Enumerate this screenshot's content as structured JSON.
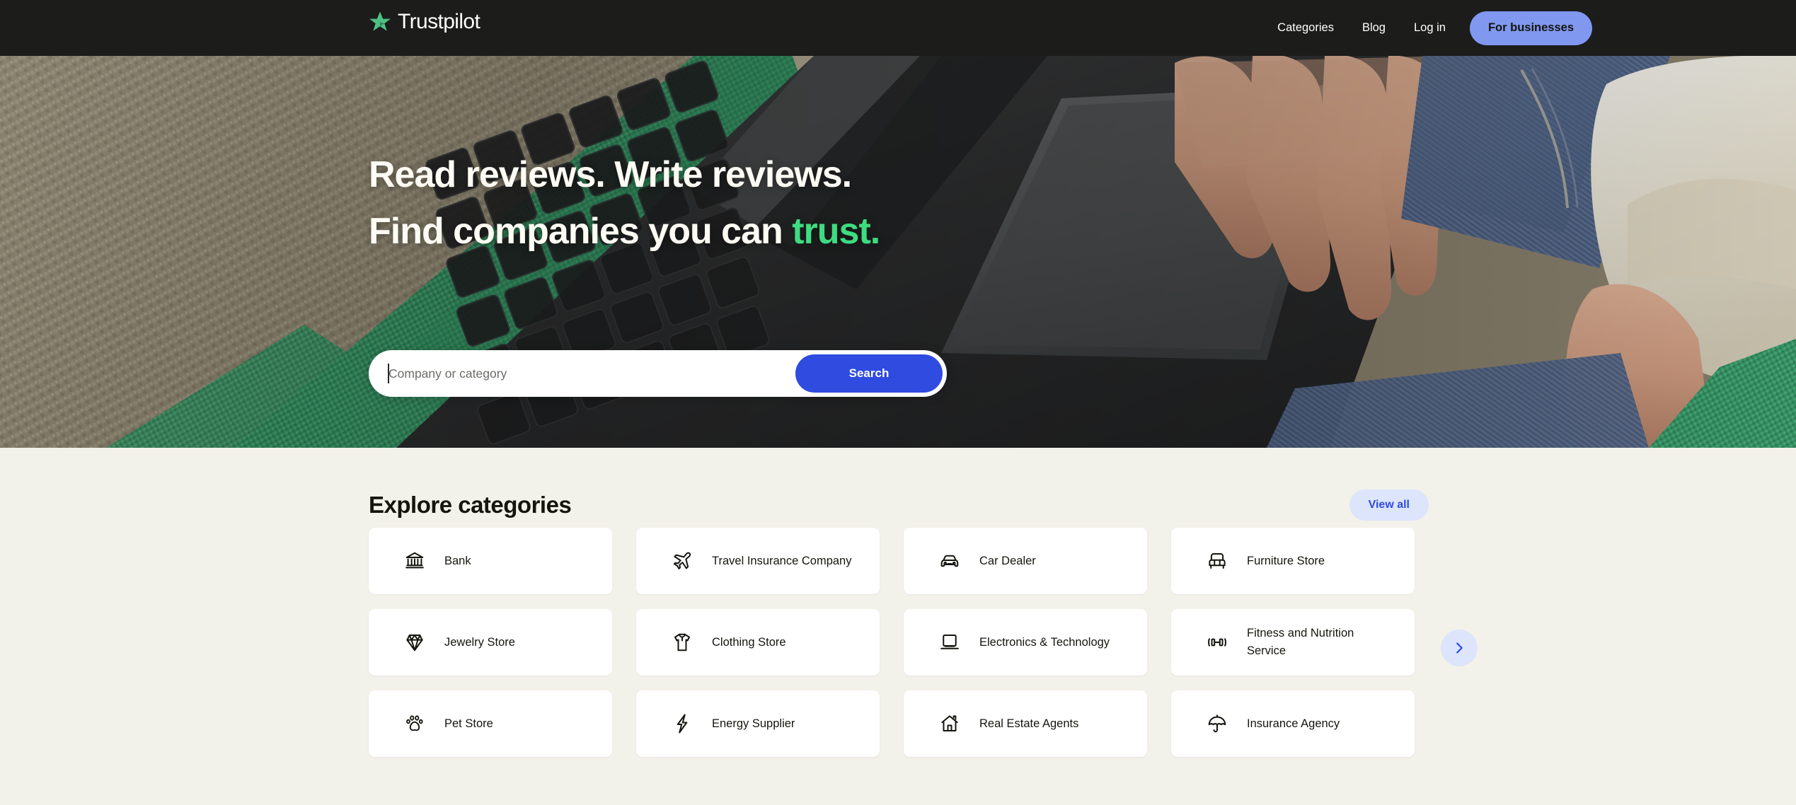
{
  "header": {
    "brand_name": "Trustpilot",
    "brand_icon": "trustpilot-star-icon",
    "nav": [
      {
        "label": "Categories",
        "name": "nav-link-categories"
      },
      {
        "label": "Blog",
        "name": "nav-link-blog"
      },
      {
        "label": "Log in",
        "name": "nav-link-login"
      }
    ],
    "cta_label": "For businesses",
    "background_color": "#1C1C1B",
    "cta_color": "#8098F0"
  },
  "hero": {
    "title_line1": "Read reviews. Write reviews.",
    "title_line2_prefix": "Find companies you can ",
    "title_line2_accent": "trust.",
    "accent_color": "#3EDC81",
    "search": {
      "placeholder": "Company or category",
      "value": "",
      "button_label": "Search",
      "button_color": "#2F4BE0"
    }
  },
  "categories_section": {
    "title": "Explore categories",
    "view_all_label": "View all",
    "view_all_color": "#2F4BE0",
    "next_icon": "chevron-right-icon",
    "cards": [
      {
        "label": "Bank",
        "icon": "bank-icon"
      },
      {
        "label": "Travel Insurance Company",
        "icon": "airplane-icon"
      },
      {
        "label": "Car Dealer",
        "icon": "car-icon"
      },
      {
        "label": "Furniture Store",
        "icon": "armchair-icon"
      },
      {
        "label": "Jewelry Store",
        "icon": "diamond-icon"
      },
      {
        "label": "Clothing Store",
        "icon": "tshirt-icon"
      },
      {
        "label": "Electronics & Technology",
        "icon": "laptop-icon"
      },
      {
        "label": "Fitness and Nutrition Service",
        "icon": "dumbbell-icon"
      },
      {
        "label": "Pet Store",
        "icon": "paw-icon"
      },
      {
        "label": "Energy Supplier",
        "icon": "lightning-bolt-icon"
      },
      {
        "label": "Real Estate Agents",
        "icon": "house-icon"
      },
      {
        "label": "Insurance Agency",
        "icon": "umbrella-icon"
      }
    ]
  },
  "page": {
    "background_color": "#F2F1EA"
  }
}
